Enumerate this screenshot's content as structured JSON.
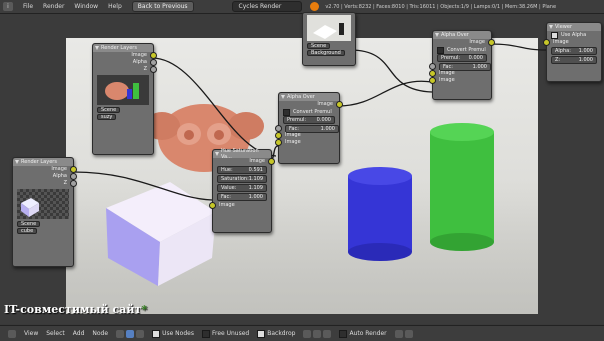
{
  "topbar": {
    "menus": [
      "File",
      "Render",
      "Window",
      "Help"
    ],
    "back_button": "Back to Previous",
    "renderer": "Cycles Render",
    "stats": "v2.70 | Verts:8232 | Faces:8010 | Tris:16011 | Objects:1/9 | Lamps:0/1 | Mem:38.26M | Plane"
  },
  "nodes": {
    "render_layers_top": {
      "title": "Render Layers",
      "outputs": [
        "Image",
        "Alpha",
        "Z"
      ],
      "scene": "Scene",
      "layer": "suzy"
    },
    "render_layers_left": {
      "title": "Render Layers",
      "outputs": [
        "Image",
        "Alpha",
        "Z"
      ],
      "scene": "Scene",
      "layer": "cube"
    },
    "render_layers_background": {
      "scene": "Scene",
      "layer": "Background"
    },
    "alpha_over_mid": {
      "title": "Alpha Over",
      "output": "Image",
      "convert_premul": "Convert Premul",
      "premul_label": "Premul:",
      "premul_value": "0.000",
      "fac_label": "Fac:",
      "fac_value": "1.000",
      "inputs": [
        "Image",
        "Image"
      ]
    },
    "alpha_over_right": {
      "title": "Alpha Over",
      "output": "Image",
      "convert_premul": "Convert Premul",
      "premul_label": "Premul:",
      "premul_value": "0.000",
      "fac_label": "Fac:",
      "fac_value": "1.000",
      "inputs": [
        "Image",
        "Image"
      ]
    },
    "hue_saturation": {
      "title": "Hue Saturation Va...",
      "output": "Image",
      "hue_label": "Hue:",
      "hue_value": "0.591",
      "sat_label": "Saturation:",
      "sat_value": "1.109",
      "val_label": "Value:",
      "val_value": "1.109",
      "fac_label": "Fac:",
      "fac_value": "1.000",
      "input": "Image"
    },
    "viewer": {
      "title": "Viewer",
      "use_alpha": "Use Alpha",
      "input_image": "Image",
      "alpha_label": "Alpha:",
      "alpha_value": "1.000",
      "z_label": "Z:",
      "z_value": "1.000"
    }
  },
  "bottombar": {
    "items": [
      "View",
      "Select",
      "Add",
      "Node"
    ],
    "use_nodes": "Use Nodes",
    "free_unused": "Free Unused",
    "backdrop": "Backdrop",
    "auto_render": "Auto Render"
  },
  "watermark": {
    "text": "IT-совместимый сайт",
    "star": "*"
  },
  "colors": {
    "socket_image": "#c7c729",
    "socket_value": "#a1a1a1",
    "socket_vector": "#6363c7",
    "blender_logo": "#e87d0d"
  }
}
